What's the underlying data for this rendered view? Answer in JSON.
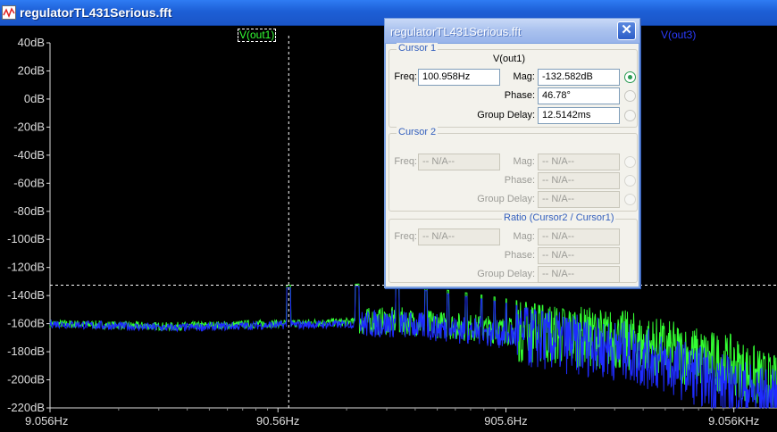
{
  "window": {
    "title": "regulatorTL431Serious.fft"
  },
  "plot": {
    "trace_labels": [
      "V(out1)",
      "V(out3)"
    ],
    "colors": {
      "trace1": "#33ff33",
      "trace3": "#1f2cff",
      "cursor": "#ffffff",
      "background": "#000000"
    }
  },
  "chart_data": {
    "type": "line",
    "x_scale": "log",
    "xlim": [
      9.056,
      14000
    ],
    "ylim": [
      -220,
      40
    ],
    "y_ticks": [
      "40dB",
      "20dB",
      "0dB",
      "-20dB",
      "-40dB",
      "-60dB",
      "-80dB",
      "-100dB",
      "-120dB",
      "-140dB",
      "-160dB",
      "-180dB",
      "-200dB",
      "-220dB"
    ],
    "x_ticks": [
      "9.056Hz",
      "90.56Hz",
      "905.6Hz",
      "9.056KHz"
    ],
    "grid": false,
    "series": [
      {
        "name": "V(out1)",
        "x": [
          9.056,
          30,
          90.56,
          100.958,
          300,
          905.6,
          3000,
          9056,
          14000
        ],
        "values": [
          -160,
          -162,
          -160,
          -132.6,
          -158,
          -165,
          -172,
          -190,
          -205
        ]
      },
      {
        "name": "V(out3)",
        "x": [
          9.056,
          30,
          90.56,
          100.958,
          300,
          905.6,
          3000,
          9056,
          14000
        ],
        "values": [
          -160,
          -163,
          -161,
          -133,
          -160,
          -168,
          -180,
          -205,
          -215
        ]
      }
    ],
    "cursor": {
      "x": 100.958,
      "y": -132.582
    }
  },
  "dialog": {
    "title": "regulatorTL431Serious.fft",
    "close_glyph": "✕",
    "cursor1": {
      "legend": "Cursor 1",
      "trace": "V(out1)",
      "freq_label": "Freq:",
      "freq": "100.958Hz",
      "mag_label": "Mag:",
      "mag": "-132.582dB",
      "phase_label": "Phase:",
      "phase": "46.78°",
      "gd_label": "Group Delay:",
      "gd": "12.5142ms"
    },
    "cursor2": {
      "legend": "Cursor 2",
      "freq_label": "Freq:",
      "freq": "-- N/A--",
      "mag_label": "Mag:",
      "mag": "-- N/A--",
      "phase_label": "Phase:",
      "phase": "-- N/A--",
      "gd_label": "Group Delay:",
      "gd": "-- N/A--"
    },
    "ratio": {
      "legend": "Ratio (Cursor2 / Cursor1)",
      "freq_label": "Freq:",
      "freq": "-- N/A--",
      "mag_label": "Mag:",
      "mag": "-- N/A--",
      "phase_label": "Phase:",
      "phase": "-- N/A--",
      "gd_label": "Group Delay:",
      "gd": "-- N/A--"
    }
  }
}
